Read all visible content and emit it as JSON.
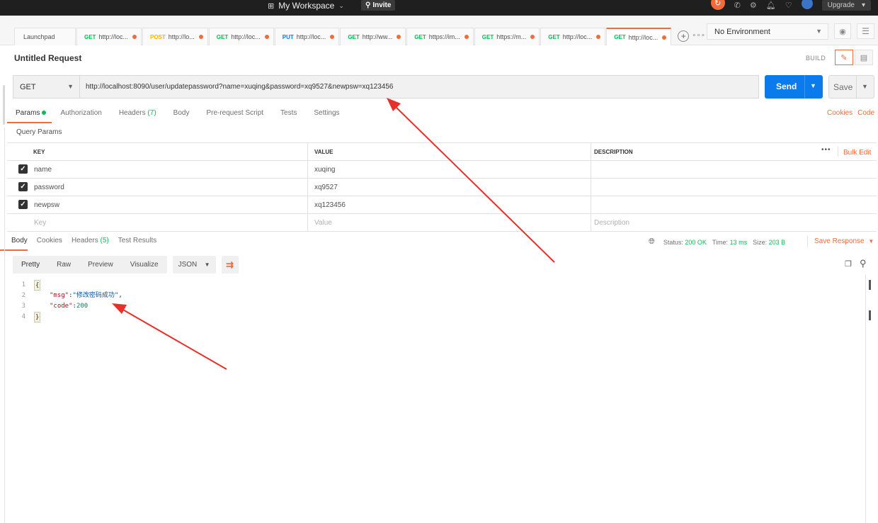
{
  "topbar": {
    "workspace": "My Workspace",
    "invite": "Invite",
    "upgrade": "Upgrade"
  },
  "tabs": [
    {
      "method": "",
      "label": "Launchpad",
      "dot": false,
      "active": false
    },
    {
      "method": "GET",
      "label": "http://loc...",
      "dot": true,
      "active": false
    },
    {
      "method": "POST",
      "label": "http://lo...",
      "dot": true,
      "active": false
    },
    {
      "method": "GET",
      "label": "http://loc...",
      "dot": true,
      "active": false
    },
    {
      "method": "PUT",
      "label": "http://loc...",
      "dot": true,
      "active": false
    },
    {
      "method": "GET",
      "label": "http://ww...",
      "dot": true,
      "active": false
    },
    {
      "method": "GET",
      "label": "https://im...",
      "dot": true,
      "active": false
    },
    {
      "method": "GET",
      "label": "https://m...",
      "dot": true,
      "active": false
    },
    {
      "method": "GET",
      "label": "http://loc...",
      "dot": true,
      "active": false
    },
    {
      "method": "GET",
      "label": "http://loc...",
      "dot": true,
      "active": true
    }
  ],
  "environment": {
    "selected": "No Environment"
  },
  "request": {
    "title": "Untitled Request",
    "build": "BUILD",
    "method": "GET",
    "url": "http://localhost:8090/user/updatepassword?name=xuqing&password=xq9527&newpsw=xq123456",
    "send": "Send",
    "save": "Save"
  },
  "request_tabs": {
    "params": "Params",
    "authorization": "Authorization",
    "headers": "Headers",
    "headers_count": "(7)",
    "body": "Body",
    "prerequest": "Pre-request Script",
    "tests": "Tests",
    "settings": "Settings",
    "cookies": "Cookies",
    "code": "Code"
  },
  "query_params": {
    "title": "Query Params",
    "columns": {
      "key": "KEY",
      "value": "VALUE",
      "description": "DESCRIPTION"
    },
    "bulk_edit": "Bulk Edit",
    "more": "•••",
    "rows": [
      {
        "key": "name",
        "value": "xuqing",
        "checked": true
      },
      {
        "key": "password",
        "value": "xq9527",
        "checked": true
      },
      {
        "key": "newpsw",
        "value": "xq123456",
        "checked": true
      }
    ],
    "placeholder": {
      "key": "Key",
      "value": "Value",
      "description": "Description"
    }
  },
  "response": {
    "tabs": {
      "body": "Body",
      "cookies": "Cookies",
      "headers": "Headers",
      "headers_count": "(5)",
      "test_results": "Test Results"
    },
    "status_label": "Status:",
    "status": "200 OK",
    "time_label": "Time:",
    "time": "13 ms",
    "size_label": "Size:",
    "size": "203 B",
    "save_response": "Save Response",
    "views": {
      "pretty": "Pretty",
      "raw": "Raw",
      "preview": "Preview",
      "visualize": "Visualize"
    },
    "format": "JSON",
    "lines": [
      {
        "n": "1",
        "text": "{"
      },
      {
        "n": "2",
        "key": "\"msg\"",
        "value": "\"修改密码成功\"",
        "tail": ","
      },
      {
        "n": "3",
        "key": "\"code\"",
        "value": "200",
        "tail": ""
      },
      {
        "n": "4",
        "text": "}"
      }
    ]
  },
  "colors": {
    "accent": "#f26b3a",
    "send": "#097bed",
    "get": "#0cbb52",
    "post": "#ffb400",
    "put": "#097bed",
    "arrow": "#e8302a"
  },
  "icons": [
    "workspace-grid-icon",
    "invite-icon",
    "sync-icon",
    "satellite-icon",
    "settings-gear-icon",
    "bell-icon",
    "heart-icon",
    "avatar-icon",
    "eye-icon",
    "env-settings-icon",
    "edit-pencil-icon",
    "doc-icon",
    "globe-icon",
    "wrap-lines-icon",
    "copy-icon",
    "search-icon"
  ]
}
